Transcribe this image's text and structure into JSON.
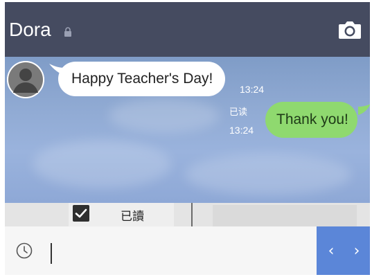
{
  "header": {
    "title": "Dora",
    "background": "#454b60",
    "icons": [
      "lock-icon",
      "camera-icon"
    ]
  },
  "chat": {
    "messages": [
      {
        "direction": "incoming",
        "text": "Happy Teacher's Day!",
        "time": "13:24",
        "bubble_color": "#ffffff"
      },
      {
        "direction": "outgoing",
        "text": "Thank you!",
        "time": "13:24",
        "read_status": "已读",
        "bubble_color": "#8fd96f"
      }
    ]
  },
  "strip": {
    "checkbox_checked": true,
    "label": "已讀"
  },
  "input": {
    "value": "",
    "icons": [
      "clock-icon"
    ],
    "nav": {
      "prev": "‹",
      "next": "›",
      "color": "#5b86d8"
    }
  }
}
